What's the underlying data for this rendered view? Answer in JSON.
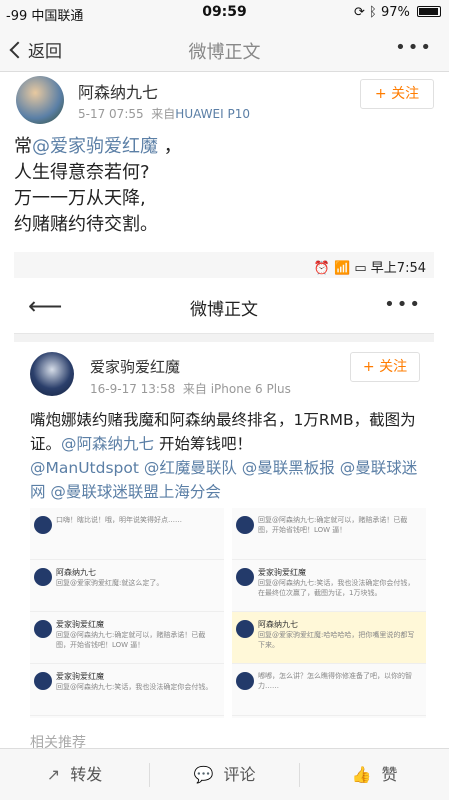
{
  "status": {
    "carrier": "-99 中国联通",
    "time": "09:59",
    "battery": "97%"
  },
  "nav": {
    "back_label": "返回",
    "title": "微博正文",
    "more": "•••"
  },
  "author": {
    "name": "阿森纳九七",
    "time": "5-17 07:55",
    "source_prefix": "来自",
    "device": "HUAWEI P10",
    "follow_label": "+ 关注"
  },
  "post": {
    "prefix": "常",
    "mention": "@爱家驹爱红魔",
    "suffix": " ，",
    "lines": [
      "人生得意奈若何?",
      "万一一万从天降,",
      "约赌赌约待交割。"
    ]
  },
  "embedded": {
    "status_time": "早上7:54",
    "nav_title": "微博正文",
    "back_glyph": "⟵",
    "more": "•••",
    "author": {
      "name": "爱家驹爱红魔",
      "time": "16-9-17 13:58",
      "source": "来自 iPhone 6 Plus",
      "follow_label": "+ 关注"
    },
    "body": {
      "text1": "嘴炮娜婊约赌我魔和阿森纳最终排名，1万RMB，截图为证。",
      "mention1": "@阿森纳九七",
      "text2": " 开始筹钱吧！",
      "mentions": "@ManUtdspot @红魔曼联队 @曼联黑板报 @曼联球迷网 @曼联球迷联盟上海分会"
    },
    "comments_left": [
      {
        "name": "",
        "text": "口嗨！瞎比说！哦，明年说笑得好点……"
      },
      {
        "name": "阿森纳九七",
        "text": "回复@爱家驹爱红魔:就这么定了。"
      },
      {
        "name": "爱家驹爱红魔",
        "text": "回复@阿森纳九七:确定就可以，赌赔承诺！已截图，开始省钱吧！LOW 逼！"
      },
      {
        "name": "爱家驹爱红魔",
        "text": "回复@阿森纳九七:笑话，我也没法确定你会付钱。"
      }
    ],
    "comments_right": [
      {
        "name": "",
        "text": "回复@阿森纳九七:确定就可以，赌赔承诺！已截图，开始省钱吧！LOW 逼！"
      },
      {
        "name": "爱家驹爱红魔",
        "text": "回复@阿森纳九七:笑话，我也没法确定你会付钱，在最终位次赢了，截图为证，1万块钱。"
      },
      {
        "name": "阿森纳九七",
        "text": "回复@爱家驹爱红魔:哈哈哈哈，把你嘴里说的都写下来。"
      },
      {
        "name": "",
        "text": "嘟嘟，怎么讲？怎么瞧得你修准备了吧，以你的智力……"
      }
    ]
  },
  "related_label": "相关推荐",
  "bottom": {
    "repost": "转发",
    "comment": "评论",
    "like": "赞"
  },
  "colors": {
    "accent": "#ff7c00",
    "link": "#5b7fa6"
  }
}
